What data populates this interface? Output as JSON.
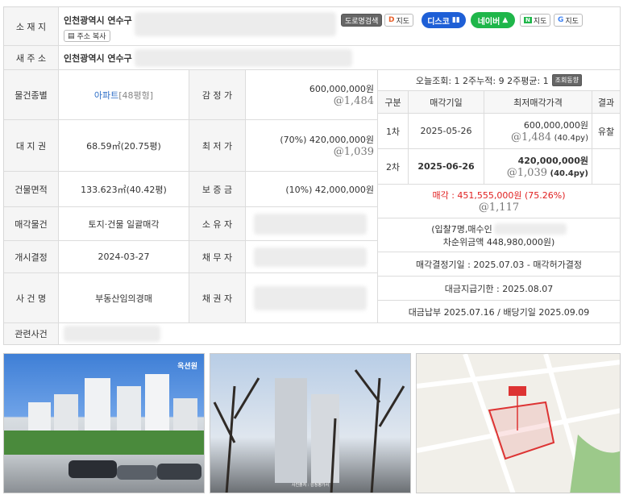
{
  "location": {
    "label": "소 재 지",
    "address": "인천광역시 연수구",
    "copy_button": "주소 복사",
    "buttons": {
      "road": "도로명검색",
      "daum_map": "지도",
      "disco": "디스코",
      "naver": "네이버",
      "naver_map": "지도",
      "google_map": "지도"
    }
  },
  "new_address": {
    "label": "새 주 소",
    "address": "인천광역시 연수구"
  },
  "rows": {
    "type_label": "물건종별",
    "type_value": "아파트",
    "type_area": "[48평형]",
    "appraisal_label": "감 정 가",
    "appraisal_price": "600,000,000원",
    "appraisal_unit": "@1,484",
    "land_label": "대 지 권",
    "land_value": "68.59㎡(20.75평)",
    "min_label": "최 저 가",
    "min_price": "(70%) 420,000,000원",
    "min_unit": "@1,039",
    "building_label": "건물면적",
    "building_value": "133.623㎡(40.42평)",
    "deposit_label": "보 증 금",
    "deposit_value": "(10%) 42,000,000원",
    "sale_label": "매각물건",
    "sale_value": "토지·건물 일괄매각",
    "owner_label": "소 유 자",
    "start_label": "개시결정",
    "start_value": "2024-03-27",
    "debtor_label": "채 무 자",
    "case_label": "사 건 명",
    "case_value": "부동산임의경매",
    "creditor_label": "채 권 자",
    "related_label": "관련사건"
  },
  "views": {
    "text": "오늘조회: 1  2주누적: 9  2주평균: 1",
    "button": "조회동향"
  },
  "history": {
    "headers": [
      "구분",
      "매각기일",
      "최저매각가격",
      "결과"
    ],
    "rows": [
      {
        "round": "1차",
        "date": "2025-05-26",
        "price": "600,000,000원",
        "unit": "@1,484",
        "py": "(40.4py)",
        "result": "유찰"
      },
      {
        "round": "2차",
        "date": "2025-06-26",
        "price": "420,000,000원",
        "unit": "@1,039",
        "py": "(40.4py)",
        "result": ""
      }
    ]
  },
  "result": {
    "sold_label": "매각 : 451,555,000원",
    "sold_pct": "(75.26%)",
    "sold_unit": "@1,117",
    "bidders_prefix": "(입찰7명,매수인",
    "second_bid": "차순위금액 448,980,000원)",
    "decision": "매각결정기일 : 2025.07.03 - 매각허가결정",
    "payment_deadline": "대금지급기한 : 2025.08.07",
    "payment_dividend": "대금납부 2025.07.16 / 배당기일 2025.09.09"
  },
  "photos": {
    "logo_text": "옥션원",
    "caption": "사진출처 : 감정평가서"
  },
  "colors": {
    "disco": "#1e5fd6",
    "naver": "#1fb64a",
    "sold_red": "#e02020",
    "label_bg": "#f5f5f5"
  }
}
